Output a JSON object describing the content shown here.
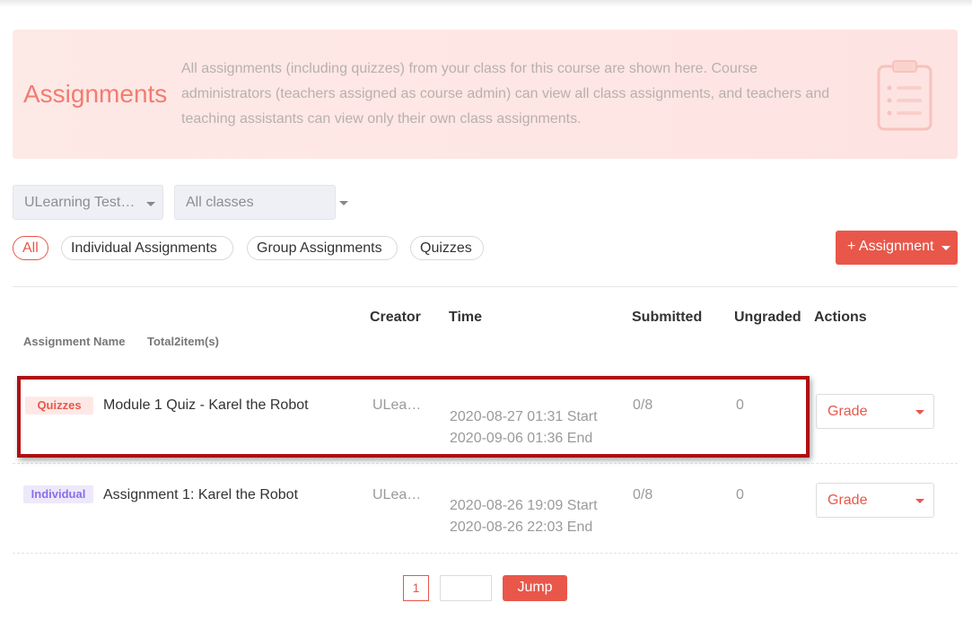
{
  "banner": {
    "title": "Assignments",
    "description": "All assignments (including quizzes) from your class for this course are shown here. Course administrators (teachers assigned as course admin) can view all class assignments, and teachers and teaching assistants can view only their own class assignments.",
    "icon": "clipboard-icon"
  },
  "filters": {
    "course_select": "ULearning Test…",
    "class_select": "All classes"
  },
  "type_tabs": [
    {
      "label": "All",
      "active": true
    },
    {
      "label": "Individual Assignments",
      "active": false
    },
    {
      "label": "Group Assignments",
      "active": false
    },
    {
      "label": "Quizzes",
      "active": false
    }
  ],
  "add_button": "+ Assignment",
  "table": {
    "headers": {
      "name": "Assignment Name",
      "total": "Total2item(s)",
      "creator": "Creator",
      "time": "Time",
      "submitted": "Submitted",
      "ungraded": "Ungraded",
      "actions": "Actions"
    },
    "rows": [
      {
        "tag": "Quizzes",
        "name": "Module 1 Quiz - Karel the Robot",
        "creator": "ULea…",
        "start": "2020-08-27 01:31 Start",
        "end": "2020-09-06 01:36 End",
        "submitted": "0/8",
        "ungraded": "0",
        "action": "Grade"
      },
      {
        "tag": "Individual",
        "name": "Assignment 1: Karel the Robot",
        "creator": "ULea…",
        "start": "2020-08-26 19:09 Start",
        "end": "2020-08-26 22:03 End",
        "submitted": "0/8",
        "ungraded": "0",
        "action": "Grade"
      }
    ]
  },
  "pagination": {
    "current_page": "1",
    "jump_label": "Jump"
  },
  "colors": {
    "accent": "#e8574a",
    "banner_title": "#f27c70",
    "highlight_border": "#b00e12"
  }
}
